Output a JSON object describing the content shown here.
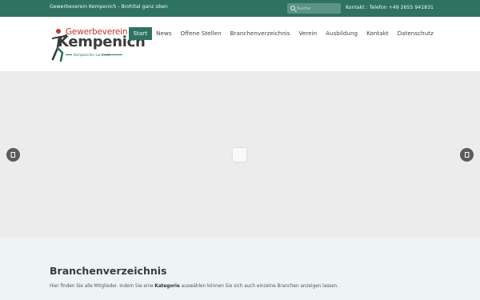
{
  "topbar": {
    "tagline": "Gewerbeverein Kempenich - Brohltal ganz oben",
    "search_placeholder": "Suche",
    "contact": "Kontakt : Telefon +49 2655 941831"
  },
  "logo": {
    "line1": "Gewerbeverein",
    "line2": "Kempenich",
    "subline": "Kempenicher Land e.V."
  },
  "nav": {
    "items": [
      {
        "label": "Start",
        "active": true
      },
      {
        "label": "News"
      },
      {
        "label": "Offene Stellen"
      },
      {
        "label": "Branchenverzeichnis"
      },
      {
        "label": "Verein"
      },
      {
        "label": "Ausbildung"
      },
      {
        "label": "Kontakt"
      },
      {
        "label": "Datenschutz"
      }
    ]
  },
  "slider": {
    "prev_icon": "chevron-left-icon",
    "next_icon": "chevron-right-icon"
  },
  "content": {
    "title": "Branchenverzeichnis",
    "intro_before": "Hier finden Sie alle Mitglieder. Indem Sie eine ",
    "intro_bold": "Kategorie",
    "intro_after": " auswählen können Sie sich auch einzelne Branchen anzeigen lassen."
  },
  "colors": {
    "brand": "#2e7263",
    "logo_red": "#c23b2b"
  }
}
